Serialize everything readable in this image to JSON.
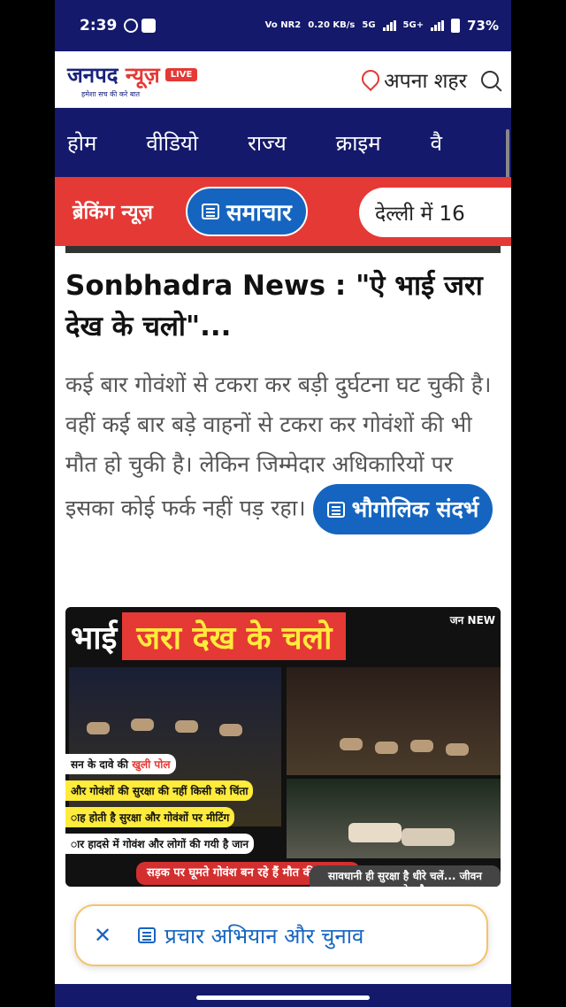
{
  "status_bar": {
    "time": "2:39",
    "network": "Vo NR2",
    "speed": "0.20 KB/s",
    "signal1": "5G",
    "signal2": "5G+",
    "battery": "73%"
  },
  "header": {
    "logo_main_a": "जनपद",
    "logo_main_b": "न्यूज़",
    "live": "LIVE",
    "tagline": "हमेशा सच की करे बात",
    "city": "अपना शहर"
  },
  "nav": {
    "items": [
      "होम",
      "वीडियो",
      "राज्य",
      "क्राइम",
      "वै"
    ]
  },
  "breaking": {
    "label": "ब्रेकिंग न्यूज़",
    "chip": "समाचार",
    "ticker": "देल्ली में 16"
  },
  "article": {
    "title": "Sonbhadra News : \"ऐ भाई जरा देख के चलो\"...",
    "body": "कई बार गोवंशों से टकरा कर बड़ी दुर्घटना घट चुकी है। वहीं कई बार बड़े वाहनों से टकरा कर गोवंशों की भी मौत हो चुकी है। लेकिन जिम्मेदार अधिकारियों पर इसका कोई फर्क नहीं पड़ रहा।",
    "chip": "भौगोलिक संदर्भ"
  },
  "image": {
    "headline_a": "भाई",
    "headline_b": "जरा देख के चलो",
    "badge": "जन NEW",
    "caption1_a": "सन के दावे की ",
    "caption1_b": "खुली पोल",
    "caption2": "और गोवंशों की सुरक्षा की नहीं किसी को चिंता",
    "caption3": "ाह होती है सुरक्षा और गोवंशों पर मीटिंग",
    "caption4": "ार हादसे में गोवंश और लोगों की गयी है जान",
    "bottom_left": "सड़क पर घूमते गोवंश बन रहे हैं मौत की वजह !",
    "bottom_right": "सावधानी ही सुरक्षा है धीरे चलें... जीवन अनमोल है"
  },
  "floating": {
    "label": "प्रचार अभियान और चुनाव"
  }
}
